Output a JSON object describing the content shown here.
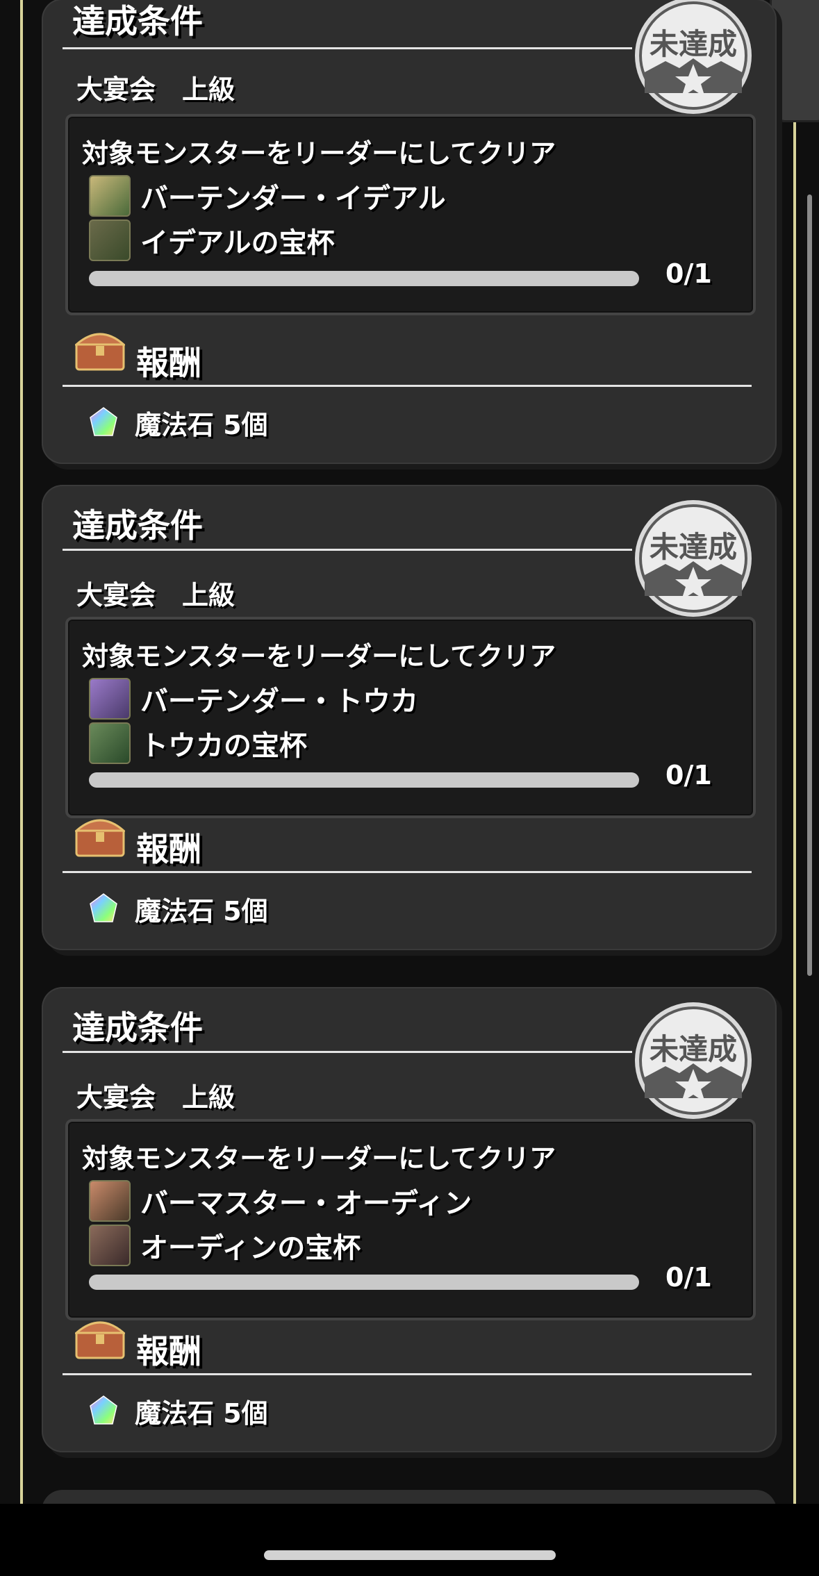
{
  "back_glyph": "〈",
  "cards": [
    {
      "condition_title": "達成条件",
      "difficulty": "大宴会　上級",
      "stamp_label": "未達成",
      "condition_text": "対象モンスターをリーダーにしてクリア",
      "monsters": [
        {
          "name": "バーテンダー・イデアル",
          "icon": "character-portrait-icon"
        },
        {
          "name": "イデアルの宝杯",
          "icon": "chalice-portrait-icon"
        }
      ],
      "progress_text": "0/1",
      "progress_fraction": 0,
      "reward_title": "報酬",
      "reward_item": "魔法石 5個"
    },
    {
      "condition_title": "達成条件",
      "difficulty": "大宴会　上級",
      "stamp_label": "未達成",
      "condition_text": "対象モンスターをリーダーにしてクリア",
      "monsters": [
        {
          "name": "バーテンダー・トウカ",
          "icon": "character-portrait-icon"
        },
        {
          "name": "トウカの宝杯",
          "icon": "chalice-portrait-icon"
        }
      ],
      "progress_text": "0/1",
      "progress_fraction": 0,
      "reward_title": "報酬",
      "reward_item": "魔法石 5個"
    },
    {
      "condition_title": "達成条件",
      "difficulty": "大宴会　上級",
      "stamp_label": "未達成",
      "condition_text": "対象モンスターをリーダーにしてクリア",
      "monsters": [
        {
          "name": "バーマスター・オーディン",
          "icon": "character-portrait-icon"
        },
        {
          "name": "オーディンの宝杯",
          "icon": "chalice-portrait-icon"
        }
      ],
      "progress_text": "0/1",
      "progress_fraction": 0,
      "reward_title": "報酬",
      "reward_item": "魔法石 5個"
    }
  ],
  "colors": {
    "card_bg": "#2e2e2e",
    "panel_bg": "#1b1b1b",
    "rail": "#d8d39a",
    "progress_track": "#c9c9c9"
  }
}
